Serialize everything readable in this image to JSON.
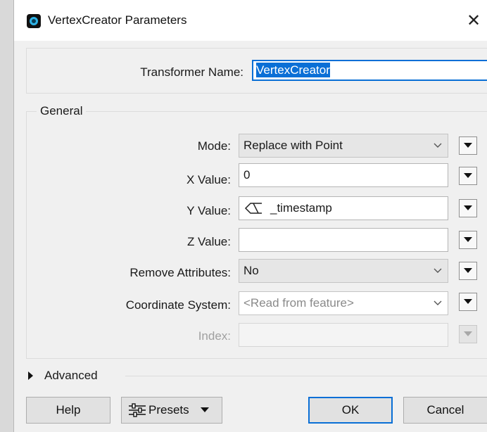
{
  "window": {
    "title": "VertexCreator Parameters",
    "close_glyph": "✕"
  },
  "transformer_name": {
    "label": "Transformer Name:",
    "value": "VertexCreator"
  },
  "general": {
    "legend": "General",
    "mode": {
      "label": "Mode:",
      "value": "Replace with Point"
    },
    "x_value": {
      "label": "X Value:",
      "value": "0"
    },
    "y_value": {
      "label": "Y Value:",
      "value": "_timestamp",
      "icon": "attribute-icon"
    },
    "z_value": {
      "label": "Z Value:",
      "value": ""
    },
    "remove_attributes": {
      "label": "Remove Attributes:",
      "value": "No"
    },
    "coordinate_system": {
      "label": "Coordinate System:",
      "value": "<Read from feature>"
    },
    "index": {
      "label": "Index:",
      "value": ""
    }
  },
  "advanced": {
    "label": "Advanced"
  },
  "buttons": {
    "help": "Help",
    "presets": "Presets",
    "ok": "OK",
    "cancel": "Cancel"
  },
  "colors": {
    "accent": "#0a6fd6",
    "icon_ring": "#2fb3e6"
  }
}
